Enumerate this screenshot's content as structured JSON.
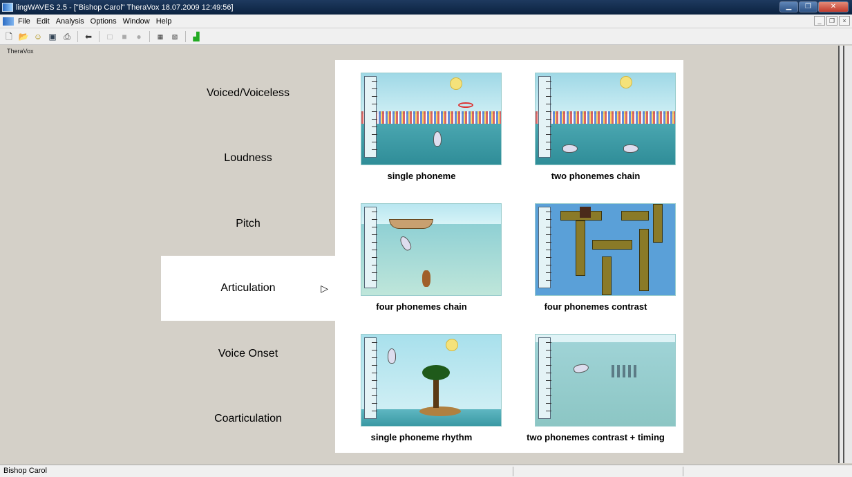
{
  "window": {
    "title": "lingWAVES 2.5 - [\"Bishop Carol\" TheraVox  18.07.2009 12:49:56]"
  },
  "menu": [
    "File",
    "Edit",
    "Analysis",
    "Options",
    "Window",
    "Help"
  ],
  "toolbar": [
    "new-icon",
    "open-icon",
    "patient-icon",
    "save-icon",
    "print-icon",
    "back-arrow-icon",
    "stop-icon",
    "record-icon",
    "play-icon",
    "compare-icon",
    "analyze-icon",
    "chart-icon"
  ],
  "document": {
    "label": "TheraVox"
  },
  "categories": [
    {
      "label": "Voiced/Voiceless"
    },
    {
      "label": "Loudness"
    },
    {
      "label": "Pitch"
    },
    {
      "label": "Articulation",
      "active": true,
      "arrow": "▷"
    },
    {
      "label": "Voice Onset"
    },
    {
      "label": "Coarticulation"
    }
  ],
  "exercises": [
    {
      "caption": "single phoneme",
      "scene": "pool-basketball"
    },
    {
      "caption": "two phonemes chain",
      "scene": "pool-two-dolphins"
    },
    {
      "caption": "four phonemes chain",
      "scene": "underwater-boat"
    },
    {
      "caption": "four phonemes contrast",
      "scene": "maze"
    },
    {
      "caption": "single phoneme rhythm",
      "scene": "island"
    },
    {
      "caption": "two phonemes contrast + timing",
      "scene": "open-sea-fish"
    }
  ],
  "status": {
    "user": "Bishop Carol"
  }
}
